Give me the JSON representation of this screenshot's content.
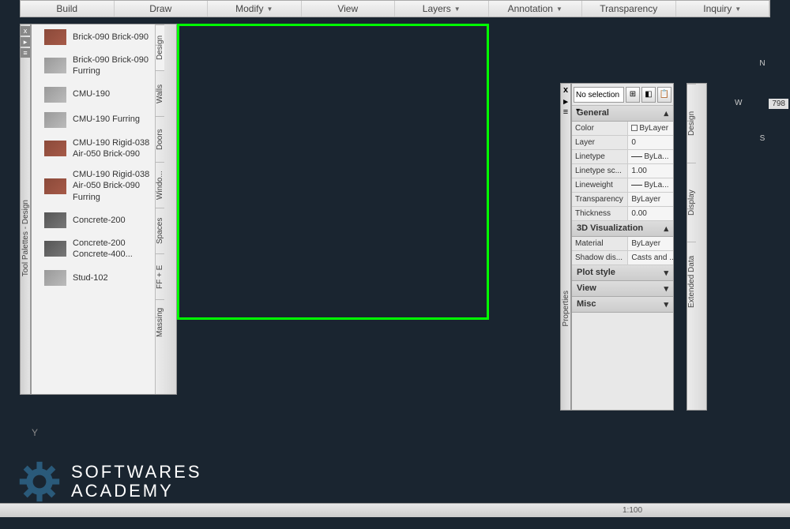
{
  "ribbon": [
    "Build",
    "Draw",
    "Modify",
    "View",
    "Layers",
    "Annotation",
    "Transparency",
    "Inquiry"
  ],
  "ribbon_dropdown": [
    false,
    false,
    true,
    false,
    true,
    true,
    false,
    true
  ],
  "palette_title": "Tool Palettes - Design",
  "palette_items": [
    {
      "label": "Brick-090 Brick-090",
      "swatch": "brick"
    },
    {
      "label": "Brick-090 Brick-090 Furring",
      "swatch": "gray"
    },
    {
      "label": "CMU-190",
      "swatch": "gray"
    },
    {
      "label": "CMU-190 Furring",
      "swatch": "gray"
    },
    {
      "label": "CMU-190 Rigid-038 Air-050 Brick-090",
      "swatch": "brick"
    },
    {
      "label": "CMU-190 Rigid-038 Air-050 Brick-090 Furring",
      "swatch": "brick"
    },
    {
      "label": "Concrete-200",
      "swatch": "dark"
    },
    {
      "label": "Concrete-200 Concrete-400...",
      "swatch": "dark"
    },
    {
      "label": "Stud-102",
      "swatch": "gray"
    }
  ],
  "palette_tabs": [
    "Design",
    "Walls",
    "Doors",
    "Windo...",
    "Spaces",
    "FF + E",
    "Massing"
  ],
  "props_title": "Properties",
  "props_selector": "No selection",
  "props_sections": {
    "general": {
      "title": "General",
      "rows": [
        {
          "k": "Color",
          "v": "ByLayer",
          "bylayer": true
        },
        {
          "k": "Layer",
          "v": "0"
        },
        {
          "k": "Linetype",
          "v": "ByLa...",
          "line": true
        },
        {
          "k": "Linetype sc...",
          "v": "1.00"
        },
        {
          "k": "Lineweight",
          "v": "ByLa...",
          "line": true
        },
        {
          "k": "Transparency",
          "v": "ByLayer"
        },
        {
          "k": "Thickness",
          "v": "0.00"
        }
      ]
    },
    "viz": {
      "title": "3D Visualization",
      "rows": [
        {
          "k": "Material",
          "v": "ByLayer"
        },
        {
          "k": "Shadow dis...",
          "v": "Casts and ..."
        }
      ]
    },
    "more": [
      "Plot style",
      "View",
      "Misc"
    ]
  },
  "props_tabs": [
    "Design",
    "Display",
    "Extended Data"
  ],
  "navcube": {
    "n": "N",
    "w": "W",
    "s": "S",
    "e": "798"
  },
  "watermark": {
    "line1": "SOFTWARES",
    "line2": "ACADEMY"
  },
  "status_scale": "1:100",
  "axis_label": "Y"
}
